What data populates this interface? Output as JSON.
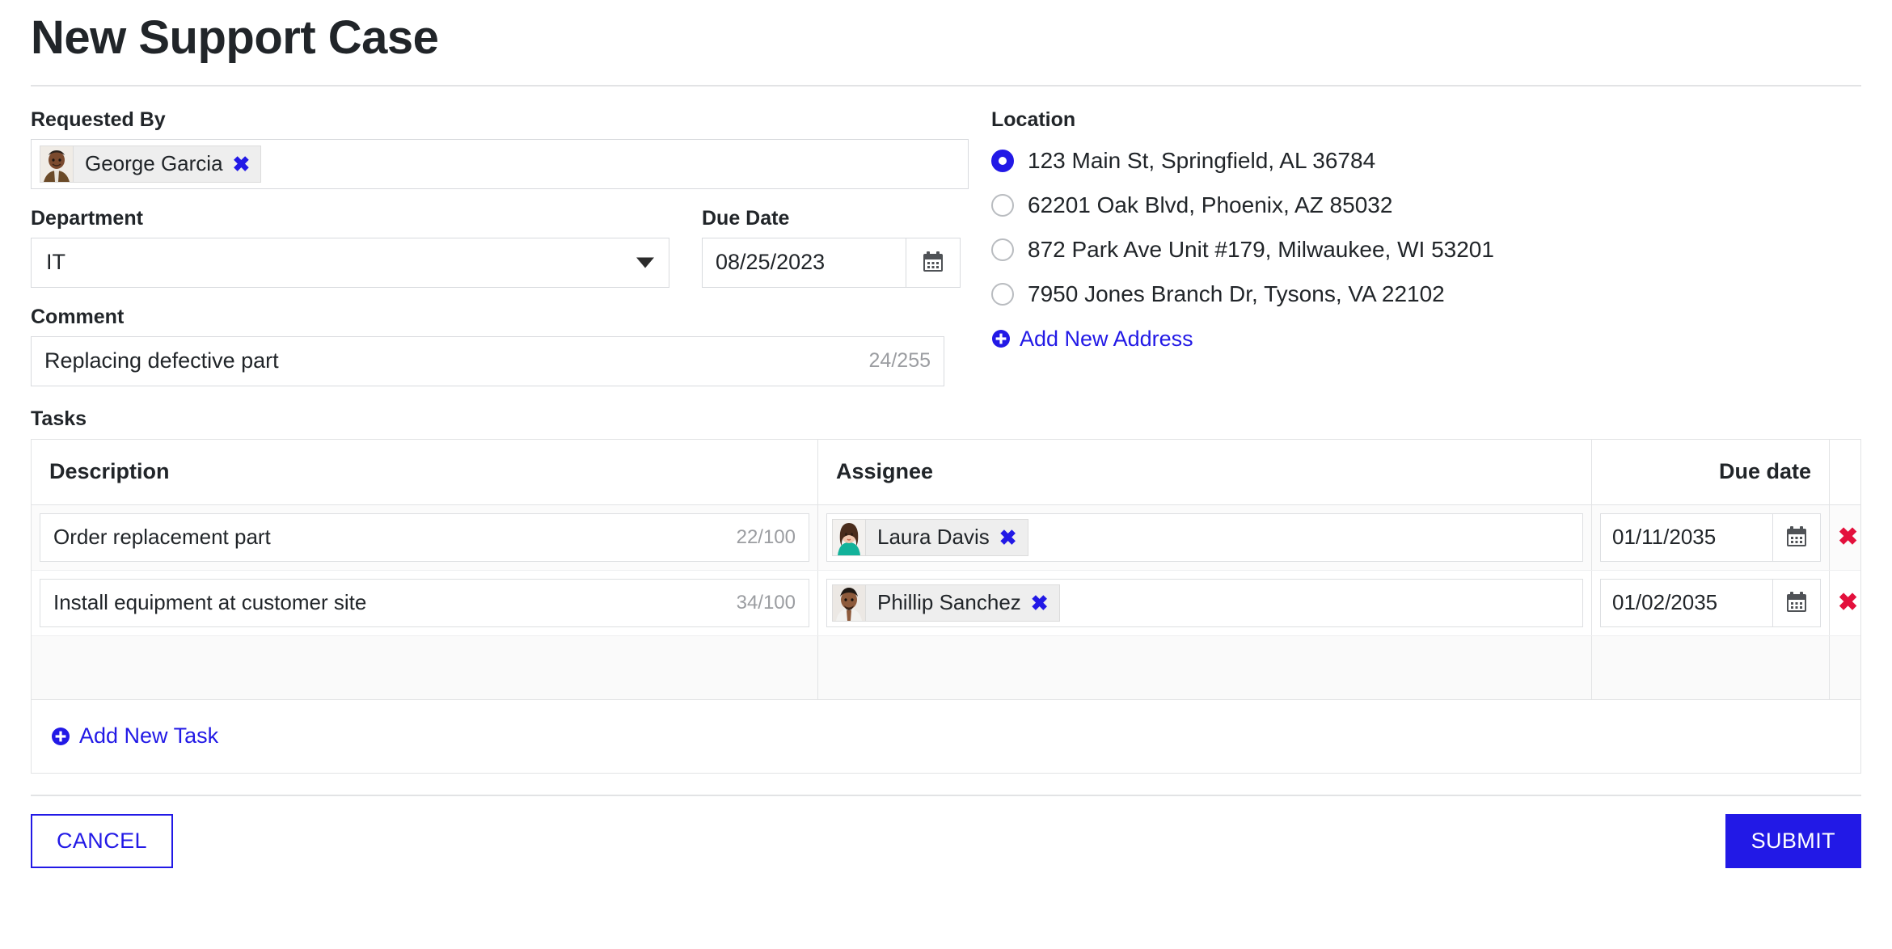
{
  "page": {
    "title": "New Support Case"
  },
  "requested_by": {
    "label": "Requested By",
    "token": {
      "name": "George Garcia",
      "remove_glyph": "✖",
      "avatar_name": "george-garcia-avatar"
    }
  },
  "department": {
    "label": "Department",
    "value": "IT"
  },
  "due_date": {
    "label": "Due Date",
    "value": "08/25/2023"
  },
  "comment": {
    "label": "Comment",
    "value": "Replacing defective part",
    "counter": "24/255"
  },
  "location": {
    "label": "Location",
    "options": [
      {
        "text": "123 Main St, Springfield, AL 36784",
        "selected": true
      },
      {
        "text": "62201 Oak Blvd, Phoenix, AZ 85032",
        "selected": false
      },
      {
        "text": "872 Park Ave Unit #179, Milwaukee, WI 53201",
        "selected": false
      },
      {
        "text": "7950 Jones Branch Dr, Tysons, VA 22102",
        "selected": false
      }
    ],
    "add_link": "Add New Address"
  },
  "tasks": {
    "label": "Tasks",
    "columns": {
      "description": "Description",
      "assignee": "Assignee",
      "due_date": "Due date"
    },
    "rows": [
      {
        "description": "Order replacement part",
        "counter": "22/100",
        "assignee": "Laura Davis",
        "assignee_remove_glyph": "✖",
        "due_date": "01/11/2035",
        "delete_glyph": "✖"
      },
      {
        "description": "Install equipment at customer site",
        "counter": "34/100",
        "assignee": "Phillip Sanchez",
        "assignee_remove_glyph": "✖",
        "due_date": "01/02/2035",
        "delete_glyph": "✖"
      }
    ],
    "add_link": "Add New Task"
  },
  "footer": {
    "cancel_label": "CANCEL",
    "submit_label": "SUBMIT"
  },
  "colors": {
    "accent": "#2219e6",
    "danger": "#e3103c",
    "border": "#e2e3e5",
    "muted_text": "#9b9da1"
  }
}
